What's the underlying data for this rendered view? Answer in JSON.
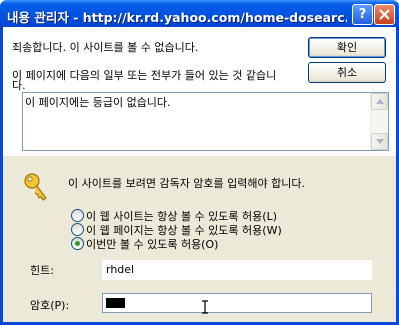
{
  "window": {
    "title": "내용 관리자 - http://kr.rd.yahoo.com/home-dosearc...",
    "help_icon": "help-icon",
    "close_icon": "close-icon"
  },
  "message": {
    "line1": "죄송합니다. 이 사이트를 볼 수 없습니다.",
    "line2a": "이 페이지에 다음의 일부 또는 전부가 들어 있는 것 같습니",
    "line2b": "다.",
    "details": "이 페이지에는 등급이 없습니다."
  },
  "buttons": {
    "ok": "확인",
    "cancel": "취소"
  },
  "supervisor": {
    "key_icon": "key-icon",
    "prompt": "이 사이트를 보려면 감독자 암호를 입력해야 합니다.",
    "options": [
      {
        "label": "이 웹 사이트는 항상 볼 수 있도록 허용(L)",
        "selected": false
      },
      {
        "label": "이 웹 페이지는 항상 볼 수 있도록 허용(W)",
        "selected": false
      },
      {
        "label": "이번만 볼 수 있도록 허용(O)",
        "selected": true
      }
    ],
    "hint_label": "힌트:",
    "hint_value": "rhdel",
    "password_label": "암호(P):"
  }
}
